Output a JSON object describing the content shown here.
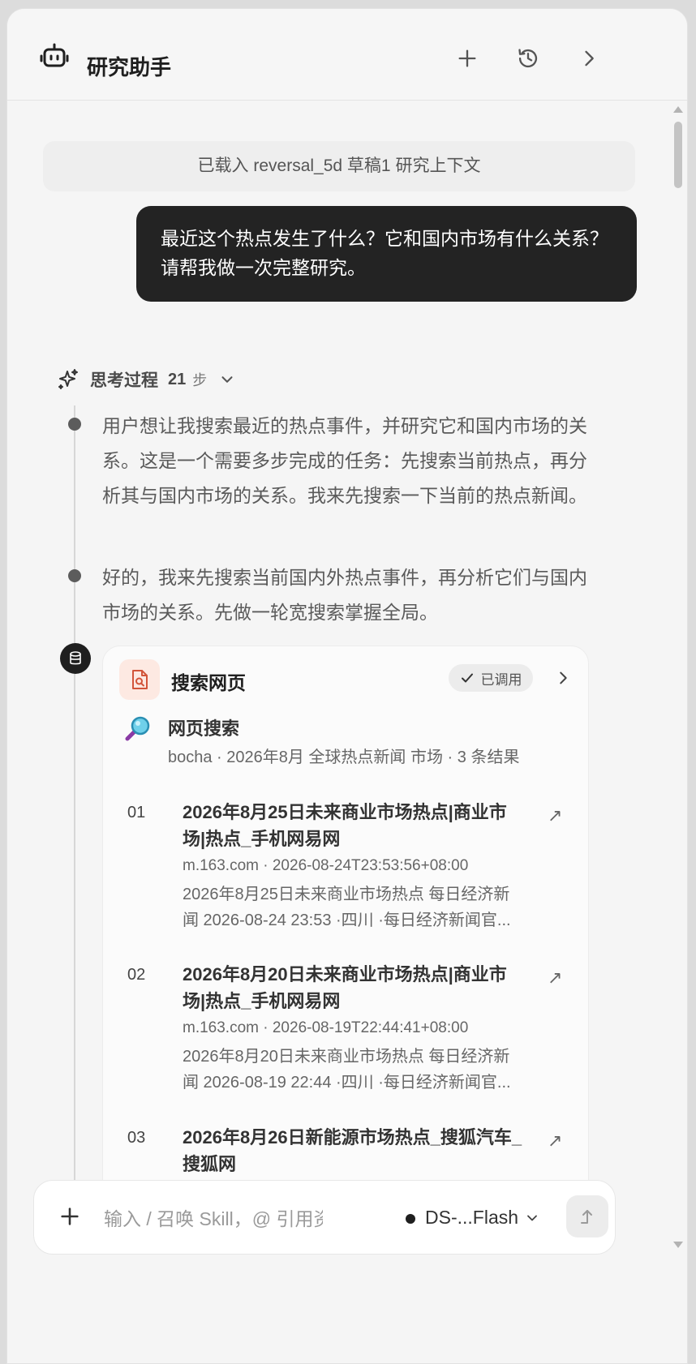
{
  "app": {
    "title": "研究助手"
  },
  "context": {
    "text": "已载入 reversal_5d 草稿1 研究上下文"
  },
  "user_message": {
    "text": "最近这个热点发生了什么？它和国内市场有什么关系？请帮我做一次完整研究。"
  },
  "thinking": {
    "label": "思考过程",
    "count": "21",
    "unit": "步",
    "steps": [
      {
        "text": "用户想让我搜索最近的热点事件，并研究它和国内市场的关系。这是一个需要多步完成的任务：先搜索当前热点，再分析其与国内市场的关系。我来先搜索一下当前的热点新闻。"
      },
      {
        "text": "好的，我来先搜索当前国内外热点事件，再分析它们与国内市场的关系。先做一轮宽搜索掌握全局。"
      }
    ]
  },
  "tool_card": {
    "title": "搜索网页",
    "status": "已调用",
    "search_title": "网页搜索",
    "search_meta": "bocha · 2026年8月 全球热点新闻 市场 · 3 条结果",
    "results": [
      {
        "num": "01",
        "title": "2026年8月25日未来商业市场热点|商业市场|热点_手机网易网",
        "source": "m.163.com · 2026-08-24T23:53:56+08:00",
        "snippet": "2026年8月25日未来商业市场热点 每日经济新闻 2026-08-24 23:53 ·四川 ·每日经济新闻官..."
      },
      {
        "num": "02",
        "title": "2026年8月20日未来商业市场热点|商业市场|热点_手机网易网",
        "source": "m.163.com · 2026-08-19T22:44:41+08:00",
        "snippet": "2026年8月20日未来商业市场热点 每日经济新闻 2026-08-19 22:44 ·四川 ·每日经济新闻官..."
      },
      {
        "num": "03",
        "title": "2026年8月26日新能源市场热点_搜狐汽车_搜狐网",
        "source": "",
        "snippet": ""
      }
    ]
  },
  "composer": {
    "placeholder": "输入 / 召唤 Skill，@ 引用资源...",
    "model": "DS-...Flash"
  },
  "icons": {
    "header": [
      "robot-icon",
      "plus-icon",
      "history-icon",
      "chevron-right-icon"
    ],
    "tool": "file-search-icon",
    "search": "magnifier-icon",
    "badge": "database-icon",
    "send": "send-icon"
  },
  "colors": {
    "user_bubble": "#232323",
    "tool_icon_bg": "#fde9e2",
    "tool_icon": "#d2553a"
  }
}
